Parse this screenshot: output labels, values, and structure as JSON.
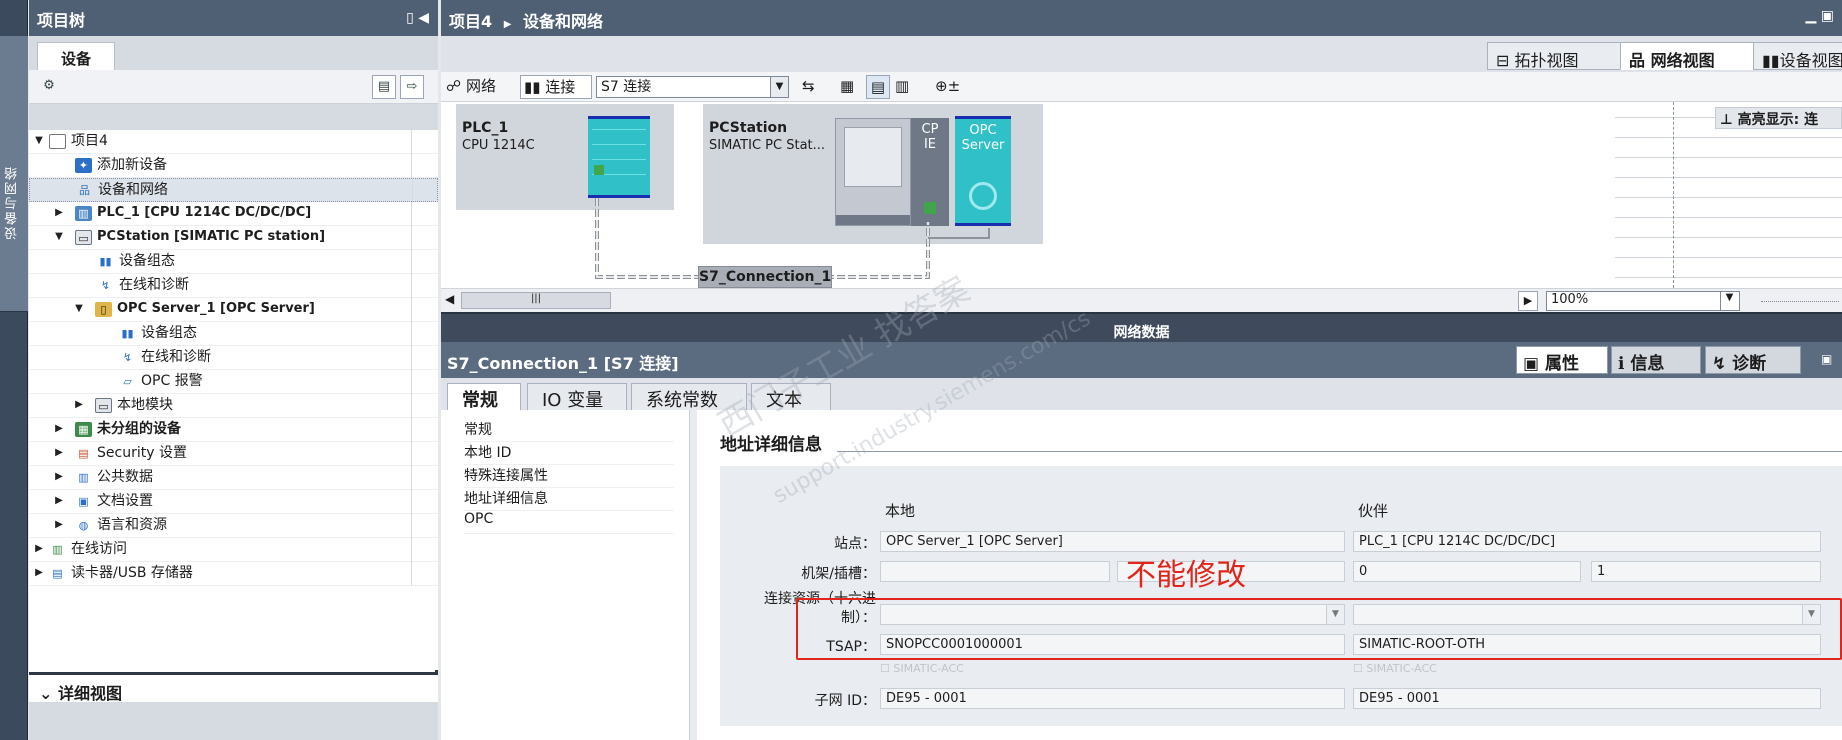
{
  "left_strip": {
    "label": "设备与网络"
  },
  "tree": {
    "title": "项目树",
    "tab": "设备",
    "rows": [
      {
        "label": "项目4"
      },
      {
        "label": "添加新设备"
      },
      {
        "label": "设备和网络"
      },
      {
        "label": "PLC_1 [CPU 1214C DC/DC/DC]"
      },
      {
        "label": "PCStation [SIMATIC PC station]"
      },
      {
        "label": "设备组态"
      },
      {
        "label": "在线和诊断"
      },
      {
        "label": "OPC Server_1 [OPC Server]"
      },
      {
        "label": "设备组态"
      },
      {
        "label": "在线和诊断"
      },
      {
        "label": "OPC 报警"
      },
      {
        "label": "本地模块"
      },
      {
        "label": "未分组的设备"
      },
      {
        "label": "Security 设置"
      },
      {
        "label": "公共数据"
      },
      {
        "label": "文档设置"
      },
      {
        "label": "语言和资源"
      },
      {
        "label": "在线访问"
      },
      {
        "label": "读卡器/USB 存储器"
      }
    ],
    "detail_view": "详细视图"
  },
  "main": {
    "breadcrumb": {
      "project": "项目4",
      "page": "设备和网络"
    },
    "view_tabs": {
      "topology": "拓扑视图",
      "network": "网络视图",
      "device": "设备视图"
    },
    "toolbar": {
      "network": "网络",
      "connect": "连接",
      "conn_type": "S7 连接"
    },
    "highlight": "高亮显示: 连",
    "devices": {
      "plc": {
        "name": "PLC_1",
        "type": "CPU 1214C"
      },
      "pc": {
        "name": "PCStation",
        "type": "SIMATIC PC Stat...",
        "cp": "CP\nIE",
        "opc": "OPC\nServer"
      }
    },
    "connection_label": "S7_Connection_1",
    "zoom": "100%",
    "splitter_label": "网络数据"
  },
  "inspector": {
    "title": "S7_Connection_1 [S7 连接]",
    "tabs": {
      "properties": "属性",
      "info": "信息",
      "diagnostics": "诊断"
    },
    "sub_tabs": [
      "常规",
      "IO 变量",
      "系统常数",
      "文本"
    ],
    "nav": [
      "常规",
      "本地 ID",
      "特殊连接属性",
      "地址详细信息",
      "OPC"
    ],
    "section_title": "地址详细信息",
    "col_local": "本地",
    "col_partner": "伙伴",
    "labels": {
      "station": "站点：",
      "rack_slot": "机架/插槽：",
      "conn_res": "连接资源（十六进制）：",
      "tsap": "TSAP：",
      "subnet": "子网 ID："
    },
    "values": {
      "local_station": "OPC Server_1 [OPC Server]",
      "partner_station": "PLC_1 [CPU 1214C DC/DC/DC]",
      "partner_rack": "0",
      "partner_slot": "1",
      "local_tsap": "SNOPCC0001000001",
      "partner_tsap": "SIMATIC-ROOT-OTH",
      "local_subnet": "DE95 - 0001",
      "partner_subnet": "DE95 - 0001",
      "acc_local": "SIMATIC-ACC",
      "acc_partner": "SIMATIC-ACC"
    },
    "annotation": "不能修改"
  },
  "watermark": {
    "line1": "西门子工业  找答案",
    "line2": "support.industry.siemens.com/cs"
  },
  "colors": {
    "header": "#4f5f74",
    "annotation": "#e1251b",
    "plc_module": "#2fc1c7"
  }
}
